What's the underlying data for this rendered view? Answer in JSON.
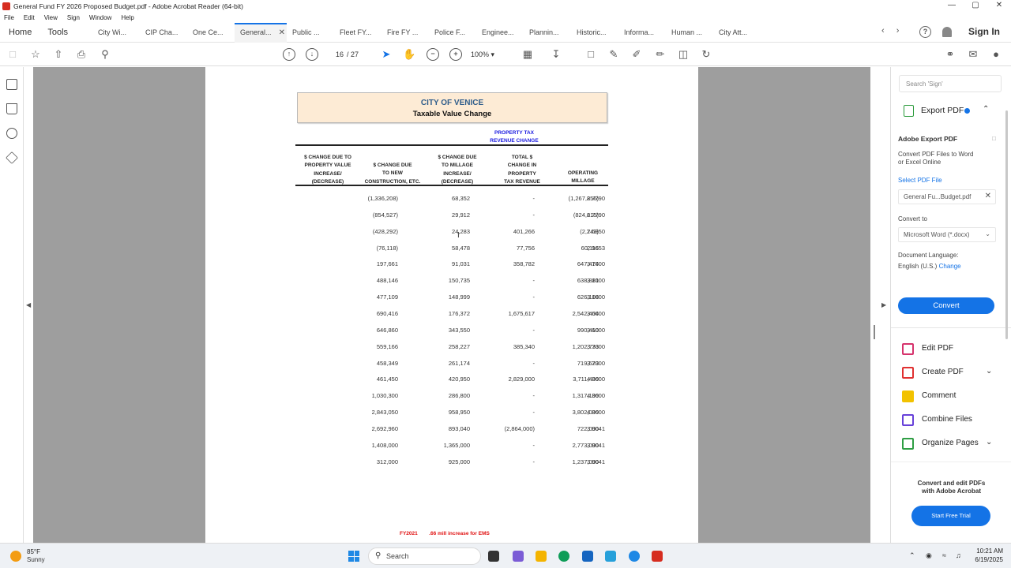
{
  "window": {
    "title": "General Fund FY 2026 Proposed Budget.pdf - Adobe Acrobat Reader (64-bit)",
    "min": "—",
    "max": "▢",
    "close": "✕"
  },
  "menu": [
    "File",
    "Edit",
    "View",
    "Sign",
    "Window",
    "Help"
  ],
  "tabs": {
    "home": "Home",
    "tools": "Tools",
    "docs": [
      "City Wi...",
      "CIP Cha...",
      "One Ce...",
      "General...",
      "Public ...",
      "Fleet FY...",
      "Fire FY ...",
      "Police F...",
      "Enginee...",
      "Plannin...",
      "Historic...",
      "Informa...",
      "Human ...",
      "City Att..."
    ],
    "active_index": 3,
    "close_symbol": "✕",
    "nav_arrows": "‹ ›",
    "help_symbol": "?",
    "signin": "Sign In"
  },
  "toolbar": {
    "page_current": "16",
    "page_total": "/ 27",
    "zoom": "100%"
  },
  "document": {
    "city": "CITY OF VENICE",
    "subtitle": "Taxable Value Change",
    "revenue_head_1": "PROPERTY TAX",
    "revenue_head_2": "REVENUE CHANGE",
    "columns": [
      [
        "$ CHANGE DUE TO",
        "PROPERTY VALUE",
        "INCREASE/",
        "(DECREASE)"
      ],
      [
        "$ CHANGE DUE",
        "TO NEW",
        "CONSTRUCTION, ETC."
      ],
      [
        "$ CHANGE DUE",
        "TO MILLAGE",
        "INCREASE/",
        "(DECREASE)"
      ],
      [
        "TOTAL $",
        "CHANGE IN",
        "PROPERTY",
        "TAX REVENUE"
      ],
      [
        "OPERATING",
        "MILLAGE"
      ]
    ],
    "rows": [
      [
        "(1,336,208)",
        "68,352",
        "-",
        "(1,267,856)",
        "2.7790"
      ],
      [
        "(854,527)",
        "29,912",
        "-",
        "(824,615)",
        "2.7790"
      ],
      [
        "(428,292)",
        "24,283",
        "401,266",
        "(2,743)",
        "2.6350"
      ],
      [
        "(76,118)",
        "58,478",
        "77,756",
        "60,116",
        "2.9653"
      ],
      [
        "197,661",
        "91,031",
        "358,782",
        "647,474",
        "3.1000"
      ],
      [
        "488,146",
        "150,735",
        "-",
        "638,881",
        "3.1000"
      ],
      [
        "477,109",
        "148,999",
        "-",
        "626,108",
        "3.1000"
      ],
      [
        "690,416",
        "176,372",
        "1,675,617",
        "2,542,404",
        "3.6000"
      ],
      [
        "646,860",
        "343,550",
        "-",
        "990,410",
        "3.6000"
      ],
      [
        "559,166",
        "258,227",
        "385,340",
        "1,202,733",
        "3.7000"
      ],
      [
        "458,349",
        "261,174",
        "-",
        "719,523",
        "3.7000"
      ],
      [
        "461,450",
        "420,950",
        "2,829,000",
        "3,711,400",
        "4.3600"
      ],
      [
        "1,030,300",
        "286,800",
        "-",
        "1,317,100",
        "4.3600"
      ],
      [
        "2,843,050",
        "958,950",
        "-",
        "3,802,000",
        "4.3600"
      ],
      [
        "2,692,960",
        "893,040",
        "(2,864,000)",
        "722,000",
        "3.9041"
      ],
      [
        "1,408,000",
        "1,365,000",
        "-",
        "2,773,000",
        "3.9041"
      ],
      [
        "312,000",
        "925,000",
        "-",
        "1,237,000",
        "3.9041"
      ]
    ],
    "footer_year": "FY2021",
    "footer_note": ".66 mill increase for EMS"
  },
  "right_panel": {
    "search_placeholder": "Search 'Sign'",
    "export_label": "Export PDF",
    "adobe_export_title": "Adobe Export PDF",
    "adobe_export_desc_1": "Convert PDF Files to Word",
    "adobe_export_desc_2": "or Excel Online",
    "select_file_label": "Select PDF File",
    "selected_file": "General Fu...Budget.pdf",
    "convert_to_label": "Convert to",
    "convert_to_value": "Microsoft Word (*.docx)",
    "doc_language_label": "Document Language:",
    "doc_language_value": "English (U.S.)",
    "change_link": "Change",
    "convert_button": "Convert",
    "tools": [
      {
        "label": "Edit PDF",
        "color": "#d6336c",
        "chevron": ""
      },
      {
        "label": "Create PDF",
        "color": "#e03131",
        "chevron": "⌄"
      },
      {
        "label": "Comment",
        "color": "#f2c200",
        "chevron": ""
      },
      {
        "label": "Combine Files",
        "color": "#6741d9",
        "chevron": ""
      },
      {
        "label": "Organize Pages",
        "color": "#2f9e44",
        "chevron": "⌄"
      }
    ],
    "promo_text_1": "Convert and edit PDFs",
    "promo_text_2": "with Adobe Acrobat",
    "promo_button": "Start Free Trial"
  },
  "taskbar": {
    "temp": "85°F",
    "condition": "Sunny",
    "search_placeholder": "Search",
    "time": "10:21 AM",
    "date": "6/19/2025"
  }
}
